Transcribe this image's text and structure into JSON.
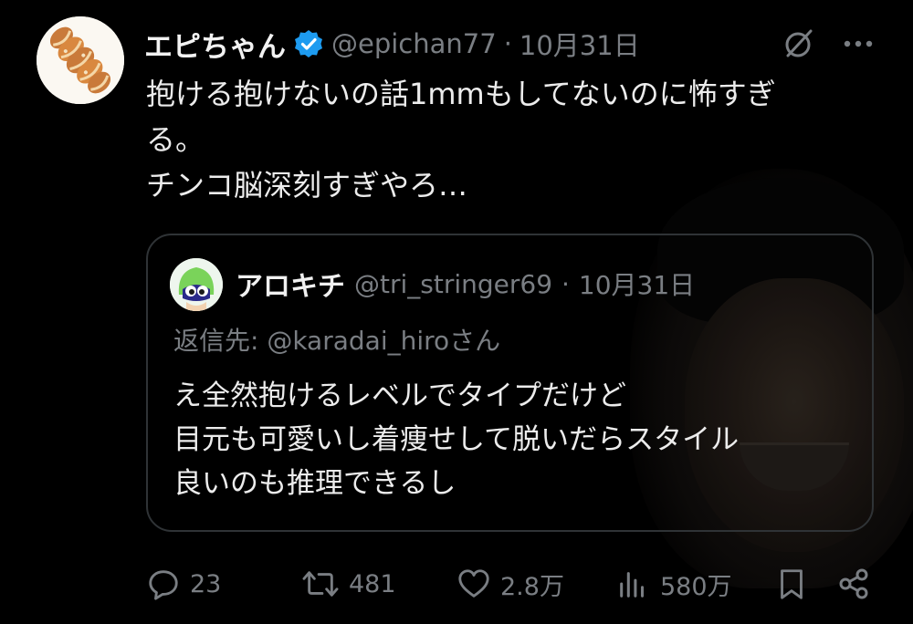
{
  "tweet": {
    "display_name": "エピちゃん",
    "handle": "@epichan77",
    "separator": "·",
    "date": "10月31日",
    "body_lines": [
      "抱ける抱けないの話1mmもしてないのに怖すぎ",
      "る。",
      "チンコ脳深刻すぎやろ…"
    ]
  },
  "quote": {
    "display_name": "アロキチ",
    "handle": "@tri_stringer69",
    "separator": "·",
    "date": "10月31日",
    "reply_to": "返信先: @karadai_hiroさん",
    "body_lines": [
      "え全然抱けるレベルでタイプだけど",
      "目元も可愛いし着痩せして脱いだらスタイル",
      "良いのも推理できるし"
    ]
  },
  "actions": {
    "replies": "23",
    "reposts": "481",
    "likes": "2.8万",
    "views": "580万"
  },
  "icons": {
    "verified": "verified-badge-icon",
    "grok": "grok-icon",
    "more": "more-icon",
    "reply": "reply-icon",
    "repost": "repost-icon",
    "like": "heart-icon",
    "views": "views-icon",
    "bookmark": "bookmark-icon",
    "share": "share-icon"
  },
  "colors": {
    "background": "#000000",
    "text_primary": "#e7e9ea",
    "text_secondary": "#7a7e83",
    "verified_blue": "#1d9bf0",
    "card_border": "#2f3336"
  }
}
